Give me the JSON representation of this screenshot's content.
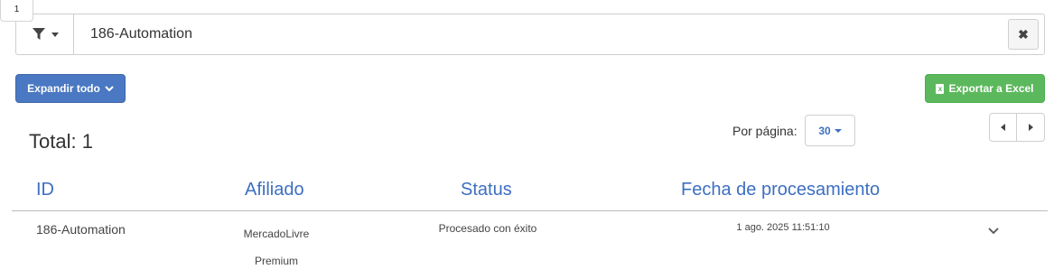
{
  "tab": {
    "badge": "1"
  },
  "filter": {
    "value": "186-Automation",
    "clear_label": "✖"
  },
  "toolbar": {
    "expand_label": "Expandir todo",
    "export_label": "Exportar a Excel"
  },
  "summary": {
    "total_label": "Total: 1"
  },
  "pagination": {
    "per_page_label": "Por página:",
    "per_page_value": "30"
  },
  "table": {
    "headers": [
      "ID",
      "Afiliado",
      "Status",
      "Fecha de procesamiento"
    ],
    "rows": [
      {
        "id": "186-Automation",
        "afiliado_line1": "MercadoLivre",
        "afiliado_line2": "Premium",
        "status": "Procesado con éxito",
        "fecha": "1 ago. 2025 11:51:10"
      }
    ]
  },
  "colors": {
    "primary": "#4a78c2",
    "success": "#5cb85c",
    "link": "#3d6fc0"
  },
  "icons": {
    "filter": "filter-icon",
    "caret": "caret-down-icon",
    "clear": "close-icon",
    "chevron_expand": "chevron-down-icon",
    "excel": "file-excel-icon",
    "prev": "chevron-left-icon",
    "next": "chevron-right-icon",
    "row_toggle": "chevron-down-icon"
  }
}
